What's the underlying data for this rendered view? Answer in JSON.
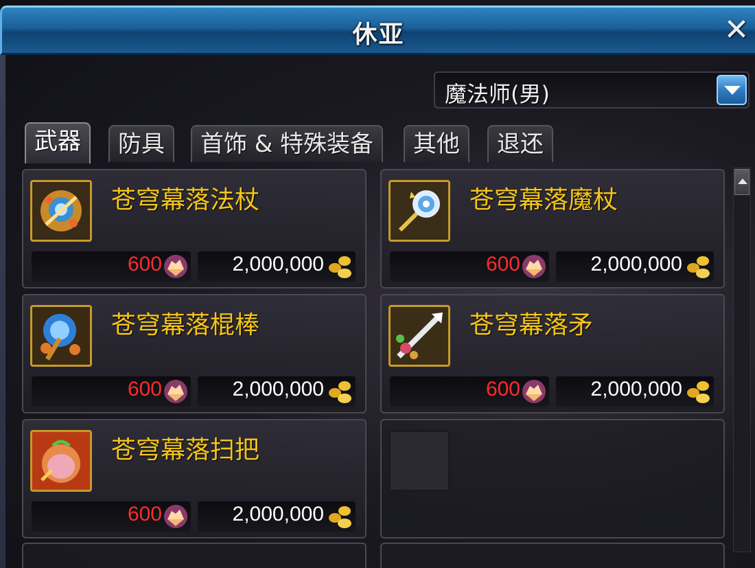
{
  "window": {
    "title": "休亚",
    "close_label": "✕"
  },
  "class_selector": {
    "selected": "魔法师(男)"
  },
  "tabs": [
    {
      "label": "武器",
      "active": true
    },
    {
      "label": "防具",
      "active": false
    },
    {
      "label": "首饰 & 特殊装备",
      "active": false
    },
    {
      "label": "其他",
      "active": false
    },
    {
      "label": "退还",
      "active": false
    }
  ],
  "items": [
    {
      "name": "苍穹幕落法杖",
      "gem_price": "600",
      "gold_price": "2,000,000",
      "icon": "staff-icon"
    },
    {
      "name": "苍穹幕落魔杖",
      "gem_price": "600",
      "gold_price": "2,000,000",
      "icon": "wand-icon"
    },
    {
      "name": "苍穹幕落棍棒",
      "gem_price": "600",
      "gold_price": "2,000,000",
      "icon": "rod-icon"
    },
    {
      "name": "苍穹幕落矛",
      "gem_price": "600",
      "gold_price": "2,000,000",
      "icon": "spear-icon"
    },
    {
      "name": "苍穹幕落扫把",
      "gem_price": "600",
      "gold_price": "2,000,000",
      "icon": "broom-icon"
    }
  ],
  "colors": {
    "item_name": "#f5c518",
    "gem_price": "#ff2b2b",
    "gold_price": "#ffffff",
    "title_bar": "#1a5f98"
  }
}
